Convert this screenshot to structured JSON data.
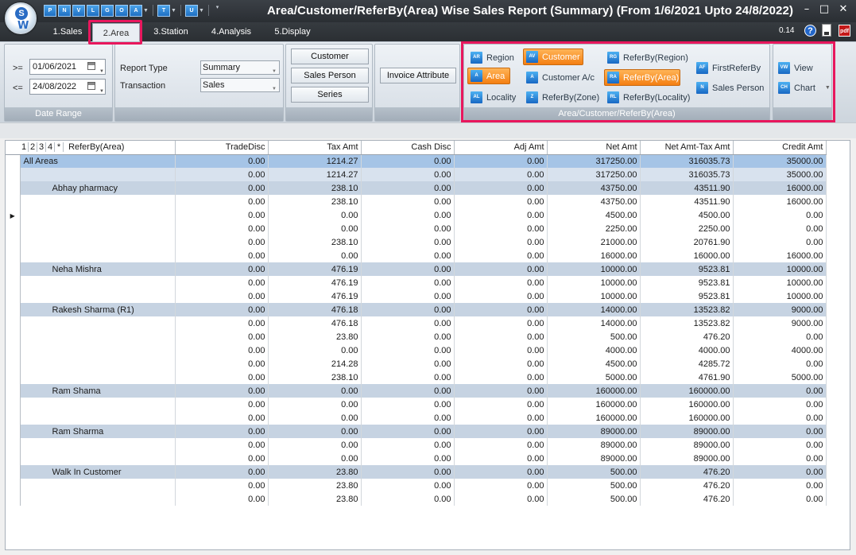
{
  "window": {
    "title": "Area/Customer/ReferBy(Area) Wise Sales Report (Summary) (From 1/6/2021 Upto 24/8/2022)",
    "minimize_glyph": "–",
    "maximize_glyph": "□",
    "close_glyph": "✕"
  },
  "quick_access": [
    "P",
    "N",
    "V",
    "L",
    "G",
    "O",
    "A",
    "T",
    "U"
  ],
  "tabs": [
    {
      "label": "1.Sales"
    },
    {
      "label": "2.Area"
    },
    {
      "label": "3.Station"
    },
    {
      "label": "4.Analysis"
    },
    {
      "label": "5.Display"
    }
  ],
  "version": "0.14",
  "icons": {
    "help": "help-icon",
    "note": "note-icon",
    "pdf": "pdf-icon",
    "pdf_text": "pdf"
  },
  "date_range": {
    "from_label": ">=",
    "from_value": "01/06/2021",
    "to_label": "<=",
    "to_value": "24/08/2022",
    "group_label": "Date Range"
  },
  "report": {
    "type_label": "Report Type",
    "type_value": "Summary",
    "transaction_label": "Transaction",
    "transaction_value": "Sales"
  },
  "filters": {
    "customer": "Customer",
    "sales_person": "Sales Person",
    "series": "Series",
    "invoice_attribute": "Invoice Attribute"
  },
  "group_by": {
    "group_label": "Area/Customer/ReferBy(Area)",
    "region": "Region",
    "area": "Area",
    "locality": "Locality",
    "customer": "Customer",
    "customer_ac": "Customer A/c",
    "referby_zone": "ReferBy(Zone)",
    "referby_region": "ReferBy(Region)",
    "referby_area": "ReferBy(Area)",
    "referby_locality": "ReferBy(Locality)",
    "first_referby": "FirstReferBy",
    "sales_person": "Sales Person"
  },
  "output": {
    "view": "View",
    "chart": "Chart"
  },
  "grid": {
    "levels": [
      "1",
      "2",
      "3",
      "4"
    ],
    "star": "*",
    "columns": [
      "ReferBy(Area)",
      "TradeDisc",
      "Tax Amt",
      "Cash Disc",
      "Adj Amt",
      "Net Amt",
      "Net Amt-Tax Amt",
      "Credit Amt"
    ],
    "rows": [
      {
        "style": "total-a",
        "name": "All Areas",
        "vals": [
          "0.00",
          "1214.27",
          "0.00",
          "0.00",
          "317250.00",
          "316035.73",
          "35000.00"
        ]
      },
      {
        "style": "total-b",
        "name": "",
        "vals": [
          "0.00",
          "1214.27",
          "0.00",
          "0.00",
          "317250.00",
          "316035.73",
          "35000.00"
        ]
      },
      {
        "style": "band",
        "name": "Abhay pharmacy",
        "vals": [
          "0.00",
          "238.10",
          "0.00",
          "0.00",
          "43750.00",
          "43511.90",
          "16000.00"
        ]
      },
      {
        "style": "plain",
        "name": "",
        "vals": [
          "0.00",
          "238.10",
          "0.00",
          "0.00",
          "43750.00",
          "43511.90",
          "16000.00"
        ]
      },
      {
        "style": "plain",
        "name": "",
        "vals": [
          "0.00",
          "0.00",
          "0.00",
          "0.00",
          "4500.00",
          "4500.00",
          "0.00"
        ],
        "current": true
      },
      {
        "style": "plain",
        "name": "",
        "vals": [
          "0.00",
          "0.00",
          "0.00",
          "0.00",
          "2250.00",
          "2250.00",
          "0.00"
        ]
      },
      {
        "style": "plain",
        "name": "",
        "vals": [
          "0.00",
          "238.10",
          "0.00",
          "0.00",
          "21000.00",
          "20761.90",
          "0.00"
        ]
      },
      {
        "style": "plain",
        "name": "",
        "vals": [
          "0.00",
          "0.00",
          "0.00",
          "0.00",
          "16000.00",
          "16000.00",
          "16000.00"
        ]
      },
      {
        "style": "band",
        "name": "Neha Mishra",
        "vals": [
          "0.00",
          "476.19",
          "0.00",
          "0.00",
          "10000.00",
          "9523.81",
          "10000.00"
        ]
      },
      {
        "style": "plain",
        "name": "",
        "vals": [
          "0.00",
          "476.19",
          "0.00",
          "0.00",
          "10000.00",
          "9523.81",
          "10000.00"
        ]
      },
      {
        "style": "plain",
        "name": "",
        "vals": [
          "0.00",
          "476.19",
          "0.00",
          "0.00",
          "10000.00",
          "9523.81",
          "10000.00"
        ]
      },
      {
        "style": "band",
        "name": "Rakesh Sharma (R1)",
        "vals": [
          "0.00",
          "476.18",
          "0.00",
          "0.00",
          "14000.00",
          "13523.82",
          "9000.00"
        ]
      },
      {
        "style": "plain",
        "name": "",
        "vals": [
          "0.00",
          "476.18",
          "0.00",
          "0.00",
          "14000.00",
          "13523.82",
          "9000.00"
        ]
      },
      {
        "style": "plain",
        "name": "",
        "vals": [
          "0.00",
          "23.80",
          "0.00",
          "0.00",
          "500.00",
          "476.20",
          "0.00"
        ]
      },
      {
        "style": "plain",
        "name": "",
        "vals": [
          "0.00",
          "0.00",
          "0.00",
          "0.00",
          "4000.00",
          "4000.00",
          "4000.00"
        ]
      },
      {
        "style": "plain",
        "name": "",
        "vals": [
          "0.00",
          "214.28",
          "0.00",
          "0.00",
          "4500.00",
          "4285.72",
          "0.00"
        ]
      },
      {
        "style": "plain",
        "name": "",
        "vals": [
          "0.00",
          "238.10",
          "0.00",
          "0.00",
          "5000.00",
          "4761.90",
          "5000.00"
        ]
      },
      {
        "style": "band",
        "name": "Ram Shama",
        "vals": [
          "0.00",
          "0.00",
          "0.00",
          "0.00",
          "160000.00",
          "160000.00",
          "0.00"
        ]
      },
      {
        "style": "plain",
        "name": "",
        "vals": [
          "0.00",
          "0.00",
          "0.00",
          "0.00",
          "160000.00",
          "160000.00",
          "0.00"
        ]
      },
      {
        "style": "plain",
        "name": "",
        "vals": [
          "0.00",
          "0.00",
          "0.00",
          "0.00",
          "160000.00",
          "160000.00",
          "0.00"
        ]
      },
      {
        "style": "band",
        "name": "Ram Sharma",
        "vals": [
          "0.00",
          "0.00",
          "0.00",
          "0.00",
          "89000.00",
          "89000.00",
          "0.00"
        ]
      },
      {
        "style": "plain",
        "name": "",
        "vals": [
          "0.00",
          "0.00",
          "0.00",
          "0.00",
          "89000.00",
          "89000.00",
          "0.00"
        ]
      },
      {
        "style": "plain",
        "name": "",
        "vals": [
          "0.00",
          "0.00",
          "0.00",
          "0.00",
          "89000.00",
          "89000.00",
          "0.00"
        ]
      },
      {
        "style": "band",
        "name": "Walk In Customer",
        "vals": [
          "0.00",
          "23.80",
          "0.00",
          "0.00",
          "500.00",
          "476.20",
          "0.00"
        ]
      },
      {
        "style": "plain",
        "name": "",
        "vals": [
          "0.00",
          "23.80",
          "0.00",
          "0.00",
          "500.00",
          "476.20",
          "0.00"
        ]
      },
      {
        "style": "plain",
        "name": "",
        "vals": [
          "0.00",
          "23.80",
          "0.00",
          "0.00",
          "500.00",
          "476.20",
          "0.00"
        ]
      }
    ]
  },
  "colors": {
    "title_bar": "#2f3338",
    "highlight": "#e8175d",
    "active_toggle": "#f58a1f",
    "band_row": "#c6d3e2",
    "total_row": "#a5c4e6"
  }
}
